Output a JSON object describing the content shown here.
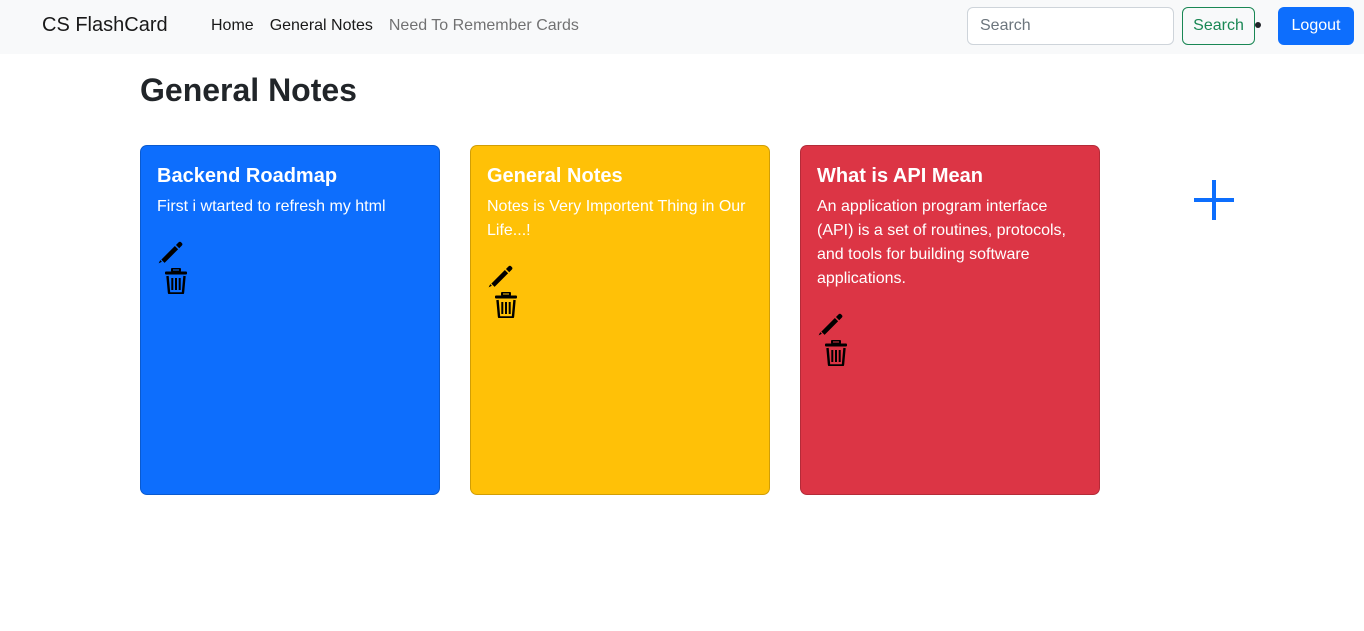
{
  "navbar": {
    "brand": "CS FlashCard",
    "links": [
      {
        "label": "Home"
      },
      {
        "label": "General Notes"
      },
      {
        "label": "Need To Remember Cards"
      }
    ],
    "search": {
      "placeholder": "Search",
      "button_label": "Search"
    },
    "logout_label": "Logout"
  },
  "page": {
    "title": "General Notes"
  },
  "cards": [
    {
      "title": "Backend Roadmap",
      "text": "First i wtarted to refresh my html",
      "color": "#0d6efd",
      "edit_icon": "pencil-icon",
      "delete_icon": "trash-icon"
    },
    {
      "title": "General Notes",
      "text": "Notes is Very Importent Thing in Our Life...!",
      "color": "#ffc107",
      "edit_icon": "pencil-icon",
      "delete_icon": "trash-icon"
    },
    {
      "title": "What is API Mean",
      "text": "An application program interface (API) is a set of routines, protocols, and tools for building software applications.",
      "color": "#dc3545",
      "edit_icon": "pencil-icon",
      "delete_icon": "trash-icon"
    }
  ],
  "add_icon": "plus-icon",
  "colors": {
    "navbar_bg": "#f8f9fa",
    "primary": "#0d6efd",
    "success": "#198754"
  }
}
